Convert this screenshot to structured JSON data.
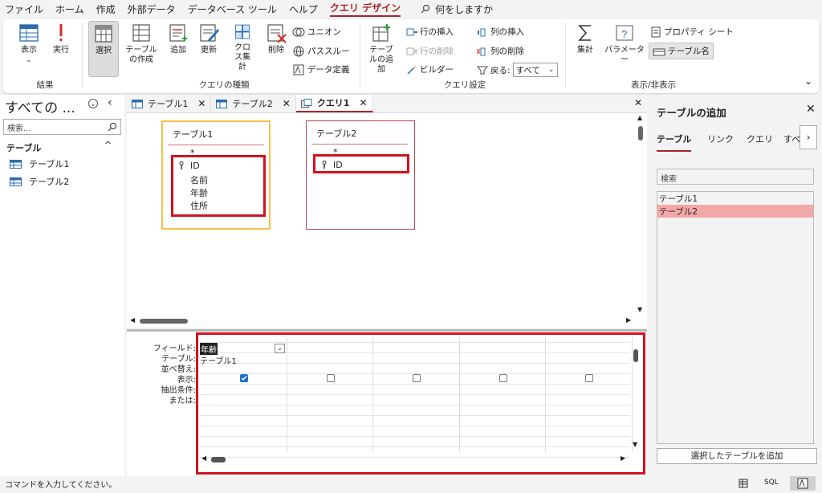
{
  "menu": {
    "items": [
      "ファイル",
      "ホーム",
      "作成",
      "外部データ",
      "データベース ツール",
      "ヘルプ",
      "クエリ デザイン"
    ],
    "active_index": 6,
    "tellme": "何をしますか"
  },
  "ribbon": {
    "results": {
      "view": "表示",
      "run": "実行",
      "group": "結果"
    },
    "querytype": {
      "select": "選択",
      "maketable": "テーブルの作成",
      "append": "追加",
      "update": "更新",
      "crosstab": "クロス集計",
      "delete": "削除",
      "union": "ユニオン",
      "passthrough": "パススルー",
      "datadef": "データ定義",
      "group": "クエリの種類"
    },
    "setup": {
      "addtable": "テーブルの追加",
      "insert_rows": "行の挿入",
      "delete_rows": "行の削除",
      "builder": "ビルダー",
      "insert_cols": "列の挿入",
      "delete_cols": "列の削除",
      "return_label": "戻る:",
      "return_value": "すべて",
      "group": "クエリ設定"
    },
    "showhide": {
      "totals": "集計",
      "parameters": "パラメーター",
      "property_sheet": "プロパティ シート",
      "table_names": "テーブル名",
      "group": "表示/非表示"
    }
  },
  "nav": {
    "title": "すべての ...",
    "search_placeholder": "検索...",
    "section": "テーブル",
    "items": [
      "テーブル1",
      "テーブル2"
    ]
  },
  "doc_tabs": [
    {
      "label": "テーブル1"
    },
    {
      "label": "テーブル2"
    },
    {
      "label": "クエリ1"
    }
  ],
  "tables": [
    {
      "title": "テーブル1",
      "star": "*",
      "fields": [
        "ID",
        "名前",
        "年齢",
        "住所"
      ]
    },
    {
      "title": "テーブル2",
      "star": "*",
      "fields": [
        "ID"
      ]
    }
  ],
  "grid": {
    "row_labels": [
      "フィールド:",
      "テーブル:",
      "並べ替え:",
      "表示:",
      "抽出条件:",
      "または:"
    ],
    "col1_field": "年齢",
    "col1_table": "テーブル1",
    "col_count": 5,
    "show_states": [
      true,
      false,
      false,
      false,
      false
    ]
  },
  "addtable": {
    "title": "テーブルの追加",
    "tabs": [
      "テーブル",
      "リンク",
      "クエリ",
      "すべ"
    ],
    "search_placeholder": "検索",
    "items": [
      "テーブル1",
      "テーブル2"
    ],
    "selected_index": 1,
    "add_button": "選択したテーブルを追加"
  },
  "status": {
    "text": "コマンドを入力してください。",
    "sql": "SQL"
  },
  "colors": {
    "accent": "#a4262c",
    "highlight_red": "#d0131e",
    "selected_row": "#f4a7a7",
    "table_border_selected": "#f5c242"
  }
}
